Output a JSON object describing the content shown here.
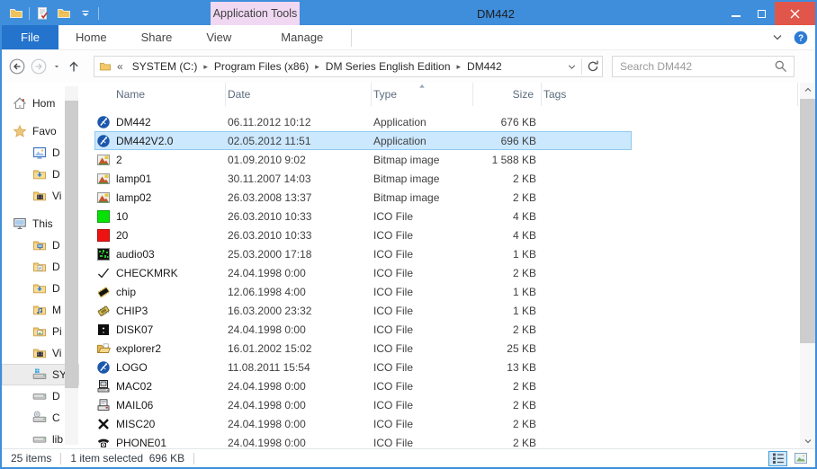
{
  "window": {
    "title": "DM442",
    "contextual_tab": "Application Tools",
    "controls": {
      "minimize": "minimize",
      "maximize": "maximize",
      "close": "close"
    }
  },
  "colors": {
    "accent": "#3e8edc",
    "file_tab": "#2473cc",
    "contextual_tab_bg": "#f0d8f3",
    "close_button": "#e0564a",
    "selection_fill": "#cce8ff",
    "selection_border": "#90c8f0"
  },
  "qat_icons": [
    "window-folder-icon",
    "properties-icon",
    "new-folder-icon",
    "qat-dropdown-icon"
  ],
  "ribbon": {
    "tabs": [
      {
        "label": "File",
        "style": "file"
      },
      {
        "label": "Home",
        "style": ""
      },
      {
        "label": "Share",
        "style": ""
      },
      {
        "label": "View",
        "style": ""
      },
      {
        "label": "Manage",
        "style": "manage"
      }
    ],
    "right_icons": [
      "collapse-ribbon-icon",
      "help-icon"
    ]
  },
  "address": {
    "overflow": "«",
    "crumbs": [
      "SYSTEM (C:)",
      "Program Files (x86)",
      "DM Series English Edition",
      "DM442"
    ],
    "separator": "▸"
  },
  "search": {
    "placeholder": "Search DM442"
  },
  "columns": {
    "name": "Name",
    "date": "Date",
    "type": "Type",
    "size": "Size",
    "tags": "Tags",
    "sorted_by": "Type",
    "sort_dir": "asc"
  },
  "files": [
    {
      "name": "DM442",
      "date": "06.11.2012 10:12",
      "type": "Application",
      "size": "676 KB",
      "icon": "application",
      "selected": false
    },
    {
      "name": "DM442V2.0",
      "date": "02.05.2012 11:51",
      "type": "Application",
      "size": "696 KB",
      "icon": "application",
      "selected": true
    },
    {
      "name": "2",
      "date": "01.09.2010 9:02",
      "type": "Bitmap image",
      "size": "1 588 KB",
      "icon": "bitmap",
      "selected": false
    },
    {
      "name": "lamp01",
      "date": "30.11.2007 14:03",
      "type": "Bitmap image",
      "size": "2 KB",
      "icon": "bitmap",
      "selected": false
    },
    {
      "name": "lamp02",
      "date": "26.03.2008 13:37",
      "type": "Bitmap image",
      "size": "2 KB",
      "icon": "bitmap",
      "selected": false
    },
    {
      "name": "10",
      "date": "26.03.2010 10:33",
      "type": "ICO File",
      "size": "4 KB",
      "icon": "green-square",
      "selected": false
    },
    {
      "name": "20",
      "date": "26.03.2010 10:33",
      "type": "ICO File",
      "size": "4 KB",
      "icon": "red-square",
      "selected": false
    },
    {
      "name": "audio03",
      "date": "25.03.2000 17:18",
      "type": "ICO File",
      "size": "1 KB",
      "icon": "audio",
      "selected": false
    },
    {
      "name": "CHECKMRK",
      "date": "24.04.1998 0:00",
      "type": "ICO File",
      "size": "2 KB",
      "icon": "checkmark",
      "selected": false
    },
    {
      "name": "chip",
      "date": "12.06.1998 4:00",
      "type": "ICO File",
      "size": "1 KB",
      "icon": "chip-dark",
      "selected": false
    },
    {
      "name": "CHIP3",
      "date": "16.03.2000 23:32",
      "type": "ICO File",
      "size": "1 KB",
      "icon": "chip-gold",
      "selected": false
    },
    {
      "name": "DISK07",
      "date": "24.04.1998 0:00",
      "type": "ICO File",
      "size": "2 KB",
      "icon": "disk",
      "selected": false
    },
    {
      "name": "explorer2",
      "date": "16.01.2002 15:02",
      "type": "ICO File",
      "size": "25 KB",
      "icon": "folder-open",
      "selected": false
    },
    {
      "name": "LOGO",
      "date": "11.08.2011 15:54",
      "type": "ICO File",
      "size": "13 KB",
      "icon": "application",
      "selected": false
    },
    {
      "name": "MAC02",
      "date": "24.04.1998 0:00",
      "type": "ICO File",
      "size": "2 KB",
      "icon": "computer",
      "selected": false
    },
    {
      "name": "MAIL06",
      "date": "24.04.1998 0:00",
      "type": "ICO File",
      "size": "2 KB",
      "icon": "mail-printer",
      "selected": false
    },
    {
      "name": "MISC20",
      "date": "24.04.1998 0:00",
      "type": "ICO File",
      "size": "2 KB",
      "icon": "x-mark",
      "selected": false
    },
    {
      "name": "PHONE01",
      "date": "24.04.1998 0:00",
      "type": "ICO File",
      "size": "2 KB",
      "icon": "phone",
      "selected": false
    }
  ],
  "sidebar": {
    "items": [
      {
        "label": "Hom",
        "icon": "home",
        "indent": 0,
        "gap": false,
        "selected": false
      },
      {
        "label": "Favo",
        "icon": "star",
        "indent": 0,
        "gap": true,
        "selected": false
      },
      {
        "label": "D",
        "icon": "desktop",
        "indent": 1,
        "gap": false,
        "selected": false
      },
      {
        "label": "D",
        "icon": "folder-download",
        "indent": 1,
        "gap": false,
        "selected": false
      },
      {
        "label": "Vi",
        "icon": "folder-video",
        "indent": 1,
        "gap": false,
        "selected": false
      },
      {
        "label": "This",
        "icon": "this-pc",
        "indent": 0,
        "gap": true,
        "selected": false
      },
      {
        "label": "D",
        "icon": "folder-desktop",
        "indent": 1,
        "gap": false,
        "selected": false
      },
      {
        "label": "D",
        "icon": "folder-doc",
        "indent": 1,
        "gap": false,
        "selected": false
      },
      {
        "label": "D",
        "icon": "folder-download",
        "indent": 1,
        "gap": false,
        "selected": false
      },
      {
        "label": "M",
        "icon": "folder-music",
        "indent": 1,
        "gap": false,
        "selected": false
      },
      {
        "label": "Pi",
        "icon": "folder-pic",
        "indent": 1,
        "gap": false,
        "selected": false
      },
      {
        "label": "Vi",
        "icon": "folder-video",
        "indent": 1,
        "gap": false,
        "selected": false
      },
      {
        "label": "SY",
        "icon": "drive-windows",
        "indent": 1,
        "gap": false,
        "selected": true
      },
      {
        "label": "D",
        "icon": "drive",
        "indent": 1,
        "gap": false,
        "selected": false
      },
      {
        "label": "C",
        "icon": "drive-cd",
        "indent": 1,
        "gap": false,
        "selected": false
      },
      {
        "label": "lib",
        "icon": "drive",
        "indent": 1,
        "gap": false,
        "selected": false
      }
    ]
  },
  "status": {
    "items_text": "25 items",
    "selection_text": "1 item selected",
    "selection_size": "696 KB",
    "view_buttons": [
      "details-view",
      "thumbnails-view"
    ]
  }
}
